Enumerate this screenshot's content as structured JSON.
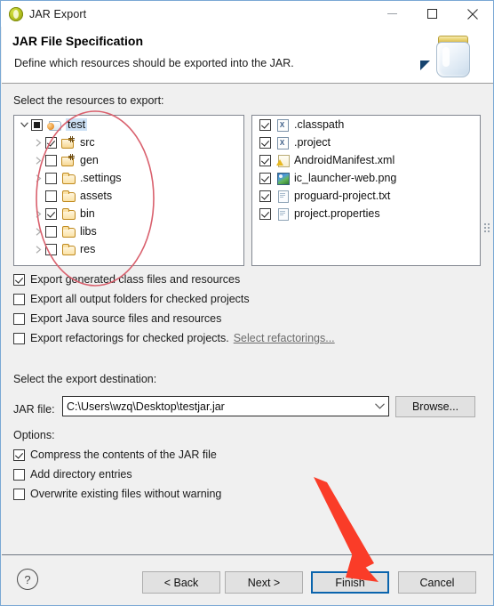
{
  "window": {
    "title": "JAR Export",
    "app_icon": "jar-export-icon",
    "controls": [
      {
        "name": "minimize",
        "glyph": "minimize-icon"
      },
      {
        "name": "maximize",
        "glyph": "maximize-icon"
      },
      {
        "name": "close",
        "glyph": "close-icon"
      }
    ]
  },
  "header": {
    "title": "JAR File Specification",
    "description": "Define which resources should be exported into the JAR.",
    "graphic": "jar-jar-icon"
  },
  "resources": {
    "label": "Select the resources to export:",
    "tree": [
      {
        "name": "test",
        "icon": "project-icon",
        "check": "partial",
        "expander": "expanded",
        "indent": 0,
        "selected": true
      },
      {
        "name": "src",
        "icon": "source-folder-icon",
        "check": "checked",
        "expander": "collapsed",
        "indent": 1,
        "selected": false
      },
      {
        "name": "gen",
        "icon": "source-folder-icon",
        "check": "unchecked",
        "expander": "collapsed",
        "indent": 1,
        "selected": false
      },
      {
        "name": ".settings",
        "icon": "folder-icon",
        "check": "unchecked",
        "expander": "collapsed",
        "indent": 1,
        "selected": false
      },
      {
        "name": "assets",
        "icon": "folder-icon",
        "check": "unchecked",
        "expander": "none",
        "indent": 1,
        "selected": false
      },
      {
        "name": "bin",
        "icon": "folder-icon",
        "check": "checked",
        "expander": "collapsed",
        "indent": 1,
        "selected": false
      },
      {
        "name": "libs",
        "icon": "folder-icon",
        "check": "unchecked",
        "expander": "collapsed",
        "indent": 1,
        "selected": false
      },
      {
        "name": "res",
        "icon": "folder-icon",
        "check": "unchecked",
        "expander": "collapsed",
        "indent": 1,
        "selected": false
      }
    ],
    "files": [
      {
        "name": ".classpath",
        "icon": "xml-x-file-icon",
        "check": "checked"
      },
      {
        "name": ".project",
        "icon": "xml-x-file-icon",
        "check": "checked"
      },
      {
        "name": "AndroidManifest.xml",
        "icon": "manifest-xml-icon",
        "check": "checked"
      },
      {
        "name": "ic_launcher-web.png",
        "icon": "png-image-icon",
        "check": "checked"
      },
      {
        "name": "proguard-project.txt",
        "icon": "text-file-icon",
        "check": "checked"
      },
      {
        "name": "project.properties",
        "icon": "properties-file-icon",
        "check": "checked"
      }
    ]
  },
  "export_options": [
    {
      "label": "Export generated class files and resources",
      "check": "checked"
    },
    {
      "label": "Export all output folders for checked projects",
      "check": "unchecked"
    },
    {
      "label": "Export Java source files and resources",
      "check": "unchecked"
    },
    {
      "label": "Export refactorings for checked projects.",
      "check": "unchecked",
      "link": "Select refactorings..."
    }
  ],
  "destination": {
    "label": "Select the export destination:",
    "jar_file_label": "JAR file:",
    "jar_file_value": "C:\\Users\\wzq\\Desktop\\testjar.jar",
    "browse_label": "Browse..."
  },
  "options": {
    "label": "Options:",
    "items": [
      {
        "label": "Compress the contents of the JAR file",
        "check": "checked"
      },
      {
        "label": "Add directory entries",
        "check": "unchecked"
      },
      {
        "label": "Overwrite existing files without warning",
        "check": "unchecked"
      }
    ]
  },
  "buttons": {
    "help": "?",
    "back": "< Back",
    "next": "Next >",
    "finish": "Finish",
    "cancel": "Cancel"
  },
  "annotations": {
    "ellipse_color": "#d9606d",
    "arrow_color": "#fa3c28"
  }
}
